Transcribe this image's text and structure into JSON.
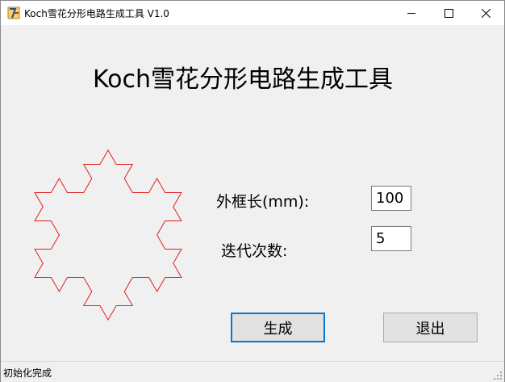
{
  "window": {
    "title": "Koch雪花分形电路生成工具 V1.0",
    "icon": "koch-app-icon",
    "controls": [
      "minimize-icon",
      "maximize-icon",
      "close-icon"
    ]
  },
  "main": {
    "heading": "Koch雪花分形电路生成工具",
    "preview": {
      "shape": "koch-snowflake",
      "stroke_color": "#e02020"
    },
    "form": {
      "frame_length_label": "外框长(mm):",
      "frame_length_value": "100",
      "iterations_label": "迭代次数:",
      "iterations_value": "5"
    },
    "buttons": {
      "generate": "生成",
      "exit": "退出"
    }
  },
  "status": {
    "text": "初始化完成"
  }
}
